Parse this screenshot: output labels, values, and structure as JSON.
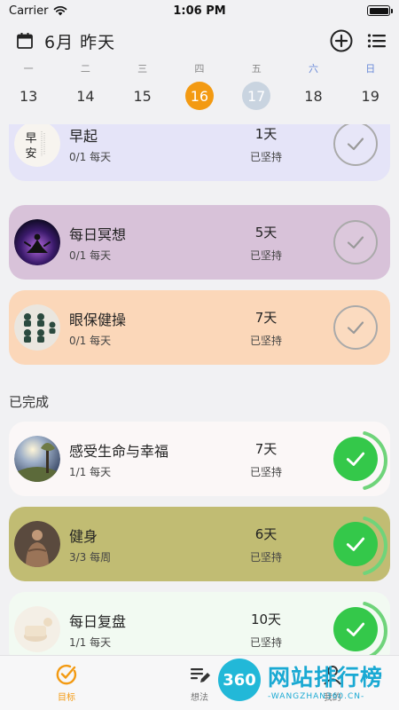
{
  "status": {
    "carrier": "Carrier",
    "time": "1:06 PM",
    "battery_level": 1.0
  },
  "header": {
    "title": "6月 昨天"
  },
  "week": {
    "weekdays": [
      "一",
      "二",
      "三",
      "四",
      "五",
      "六",
      "日"
    ],
    "dates": [
      "13",
      "14",
      "15",
      "16",
      "17",
      "18",
      "19"
    ],
    "today": "16",
    "selected": "17"
  },
  "habits": [
    {
      "title": "早起",
      "frequency": "0/1 每天",
      "count": "1天",
      "count_label": "已坚持",
      "done": false,
      "color": "#e5e4f8",
      "avatar_text": "早安"
    },
    {
      "title": "每日冥想",
      "frequency": "0/1 每天",
      "count": "5天",
      "count_label": "已坚持",
      "done": false,
      "color": "#d8c2d9"
    },
    {
      "title": "眼保健操",
      "frequency": "0/1 每天",
      "count": "7天",
      "count_label": "已坚持",
      "done": false,
      "color": "#fbd7b9"
    }
  ],
  "completed_label": "已完成",
  "completed": [
    {
      "title": "感受生命与幸福",
      "frequency": "1/1 每天",
      "count": "7天",
      "count_label": "已坚持",
      "done": true,
      "color": "#fbf7f7",
      "progress": 1.0
    },
    {
      "title": "健身",
      "frequency": "3/3 每周",
      "count": "6天",
      "count_label": "已坚持",
      "done": true,
      "color": "#c1bc73",
      "progress": 1.0
    },
    {
      "title": "每日复盘",
      "frequency": "1/1 每天",
      "count": "10天",
      "count_label": "已坚持",
      "done": true,
      "color": "#f2faf2",
      "progress": 1.0
    }
  ],
  "tabbar": {
    "tabs": [
      "目标",
      "想法",
      "我的"
    ],
    "active": "目标"
  },
  "watermark": {
    "logo": "360",
    "text": "网站排行榜",
    "sub": "-WANGZHAN360.CN-"
  },
  "colors": {
    "accent": "#f39a12",
    "done_green": "#34c84a",
    "ring_green": "#6fd47a"
  }
}
